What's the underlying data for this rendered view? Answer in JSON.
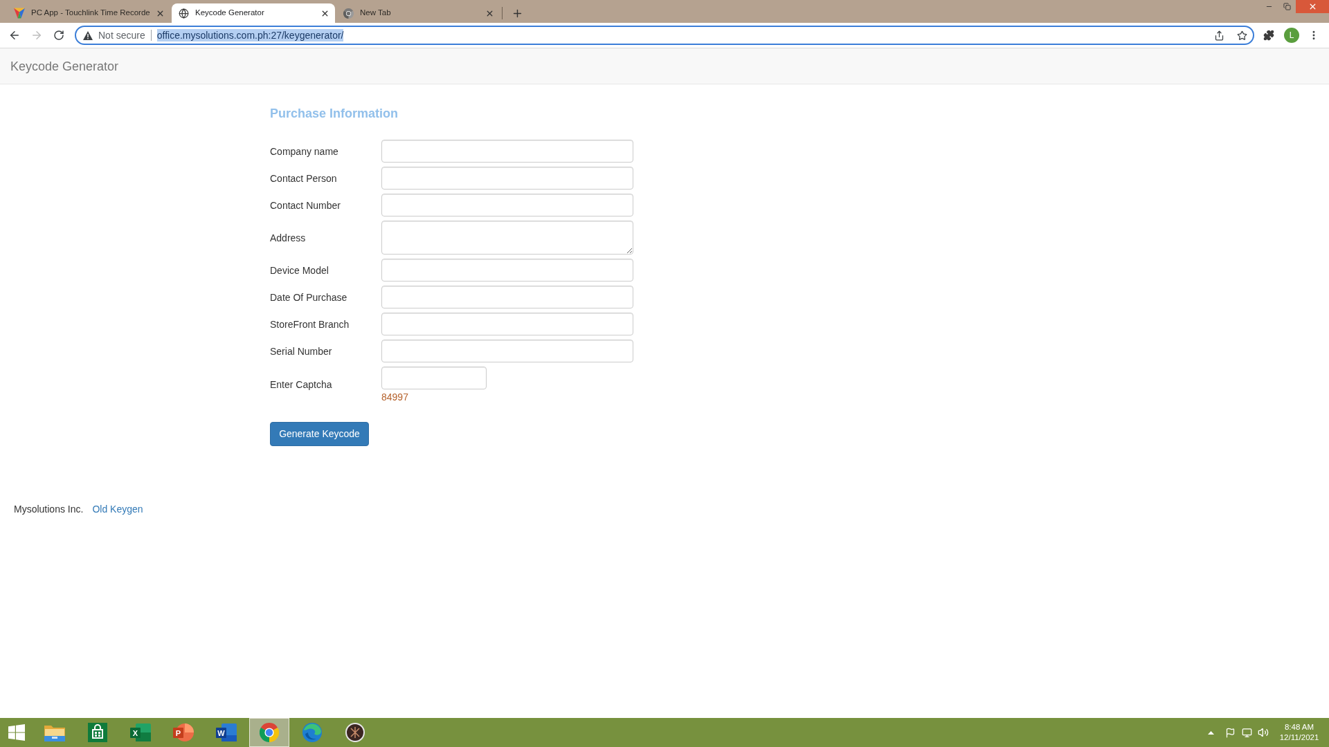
{
  "browser": {
    "tabs": [
      {
        "kind": "app",
        "title": "PC App - Touchlink Time Recorde",
        "selected": false
      },
      {
        "kind": "web",
        "title": "Keycode Generator",
        "selected": true
      },
      {
        "kind": "new",
        "title": "New Tab",
        "selected": false
      }
    ],
    "navigation": {
      "back_disabled": false,
      "forward_disabled": true
    },
    "address_bar": {
      "focused": true,
      "security": "Not secure",
      "url": "office.mysolutions.com.ph:27/keygenerator/",
      "url_selected": true
    },
    "profile": {
      "initial": "L"
    }
  },
  "page": {
    "brand": "Keycode Generator",
    "form": {
      "heading": "Purchase Information",
      "fields": [
        {
          "kind": "text",
          "label": "Company name"
        },
        {
          "kind": "text",
          "label": "Contact Person"
        },
        {
          "kind": "text",
          "label": "Contact Number"
        },
        {
          "kind": "textarea",
          "label": "Address"
        },
        {
          "kind": "text",
          "label": "Device Model"
        },
        {
          "kind": "text",
          "label": "Date Of Purchase"
        },
        {
          "kind": "text",
          "label": "StoreFront Branch"
        },
        {
          "kind": "text",
          "label": "Serial Number"
        },
        {
          "kind": "captcha",
          "label": "Enter Captcha",
          "code": "84997"
        }
      ],
      "submit": "Generate Keycode"
    },
    "footer": {
      "company": "Mysolutions Inc.",
      "link": "Old Keygen"
    }
  },
  "taskbar": {
    "apps": [
      {
        "kind": "folder",
        "selected": false
      },
      {
        "kind": "store",
        "selected": false
      },
      {
        "kind": "spreadsheet",
        "label": "X",
        "selected": false
      },
      {
        "kind": "presentation",
        "label": "P",
        "selected": false
      },
      {
        "kind": "document",
        "label": "W",
        "selected": false
      },
      {
        "kind": "browser",
        "selected": true
      },
      {
        "kind": "browser_alt",
        "selected": false
      },
      {
        "kind": "disc",
        "selected": false
      }
    ],
    "clock": {
      "time": "8:48 AM",
      "date": "12/11/2021"
    }
  }
}
